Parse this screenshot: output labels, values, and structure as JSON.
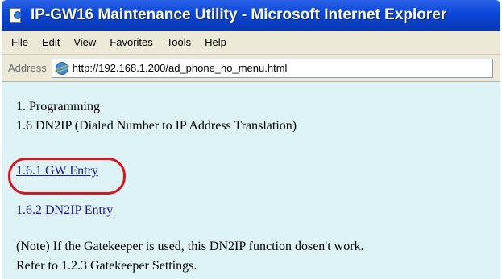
{
  "window": {
    "title": "IP-GW16 Maintenance Utility - Microsoft Internet Explorer",
    "icon": "ie-page-icon"
  },
  "menubar": {
    "items": [
      "File",
      "Edit",
      "View",
      "Favorites",
      "Tools",
      "Help"
    ]
  },
  "addressbar": {
    "label": "Address",
    "url": "http://192.168.1.200/ad_phone_no_menu.html",
    "icon": "ie-page-icon"
  },
  "content": {
    "section_title": "1. Programming",
    "subsection_title": "1.6 DN2IP (Dialed Number to IP Address Translation)",
    "links": [
      {
        "label": "1.6.1 GW Entry",
        "highlighted": true
      },
      {
        "label": "1.6.2 DN2IP Entry",
        "highlighted": false
      }
    ],
    "note_line1": "(Note) If the Gatekeeper is used, this DN2IP function dosen't work.",
    "note_line2": "Refer to 1.2.3 Gatekeeper Settings."
  },
  "colors": {
    "titlebar": "#0a46d8",
    "content_background": "#ddf3f6",
    "link": "#1a1aa8",
    "highlight_ring": "#e0121b"
  }
}
